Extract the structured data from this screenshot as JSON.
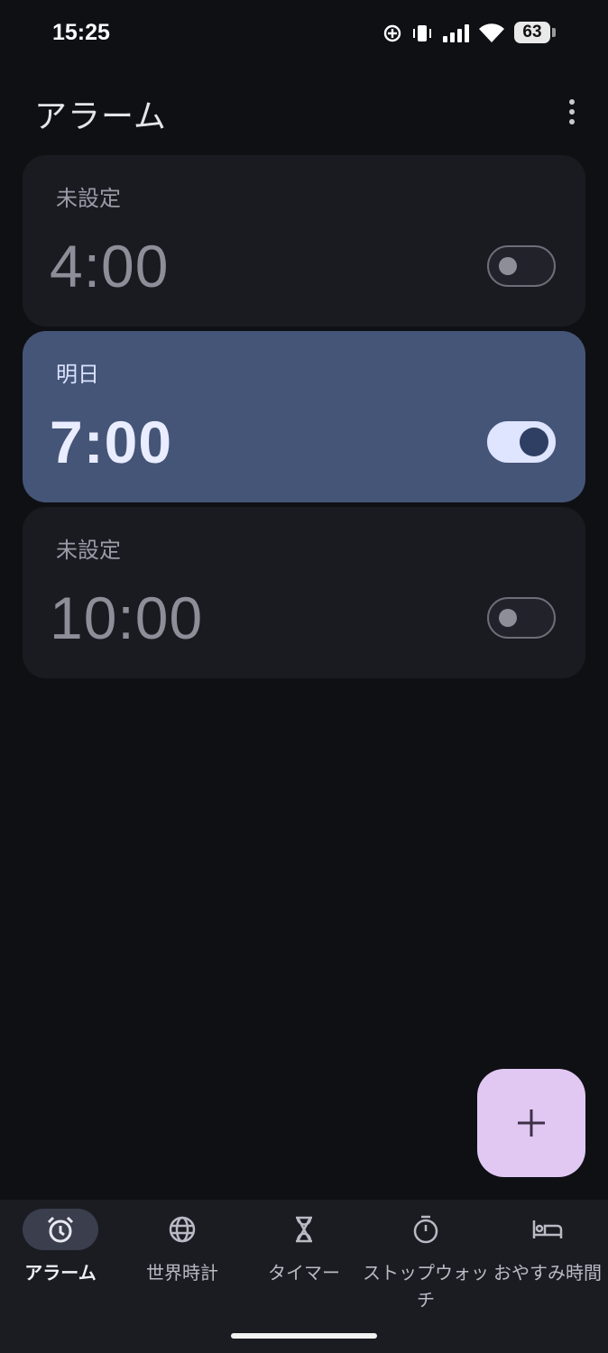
{
  "status_bar": {
    "time": "15:25",
    "battery": "63",
    "icons": [
      "location-target-icon",
      "vibrate-icon",
      "signal-icon",
      "wifi-icon",
      "battery-icon"
    ]
  },
  "header": {
    "title": "アラーム",
    "more_icon": "more-vert-icon"
  },
  "alarms": [
    {
      "label": "未設定",
      "time": "4:00",
      "enabled": false
    },
    {
      "label": "明日",
      "time": "7:00",
      "enabled": true
    },
    {
      "label": "未設定",
      "time": "10:00",
      "enabled": false
    }
  ],
  "fab": {
    "icon": "plus-icon"
  },
  "bottom_nav": [
    {
      "label": "アラーム",
      "icon": "alarm-clock-icon",
      "selected": true
    },
    {
      "label": "世界時計",
      "icon": "globe-icon",
      "selected": false
    },
    {
      "label": "タイマー",
      "icon": "hourglass-icon",
      "selected": false
    },
    {
      "label": "ストップウォッチ",
      "icon": "stopwatch-icon",
      "selected": false
    },
    {
      "label": "おやすみ時間",
      "icon": "bed-icon",
      "selected": false
    }
  ],
  "colors": {
    "background": "#0f1014",
    "card": "#1a1b21",
    "card_active": "#455577",
    "fab": "#e0c8f3",
    "nav_bar": "#1b1c22"
  }
}
